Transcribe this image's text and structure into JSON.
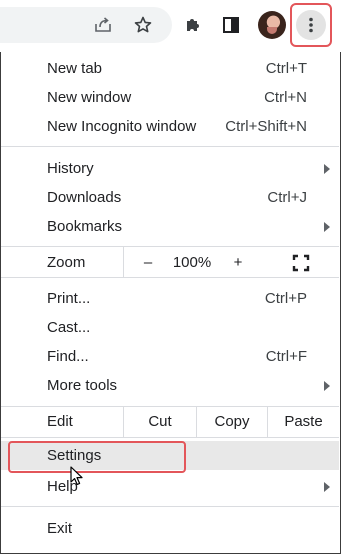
{
  "toolbar": {
    "icons": [
      "share-icon",
      "star-icon",
      "extensions-icon",
      "side-panel-icon",
      "avatar",
      "more-vert-icon"
    ]
  },
  "menu": {
    "new_tab": {
      "label": "New tab",
      "shortcut": "Ctrl+T"
    },
    "new_window": {
      "label": "New window",
      "shortcut": "Ctrl+N"
    },
    "new_incognito": {
      "label": "New Incognito window",
      "shortcut": "Ctrl+Shift+N"
    },
    "history": {
      "label": "History"
    },
    "downloads": {
      "label": "Downloads",
      "shortcut": "Ctrl+J"
    },
    "bookmarks": {
      "label": "Bookmarks"
    },
    "zoom": {
      "label": "Zoom",
      "minus": "–",
      "value": "100%",
      "plus": "+"
    },
    "print": {
      "label": "Print...",
      "shortcut": "Ctrl+P"
    },
    "cast": {
      "label": "Cast..."
    },
    "find": {
      "label": "Find...",
      "shortcut": "Ctrl+F"
    },
    "more_tools": {
      "label": "More tools"
    },
    "edit": {
      "label": "Edit",
      "cut": "Cut",
      "copy": "Copy",
      "paste": "Paste"
    },
    "settings": {
      "label": "Settings"
    },
    "help": {
      "label": "Help"
    },
    "exit": {
      "label": "Exit"
    }
  },
  "colors": {
    "highlight": "#e3565a",
    "hover_bg": "#e8e8e8",
    "separator": "#dadce0"
  }
}
